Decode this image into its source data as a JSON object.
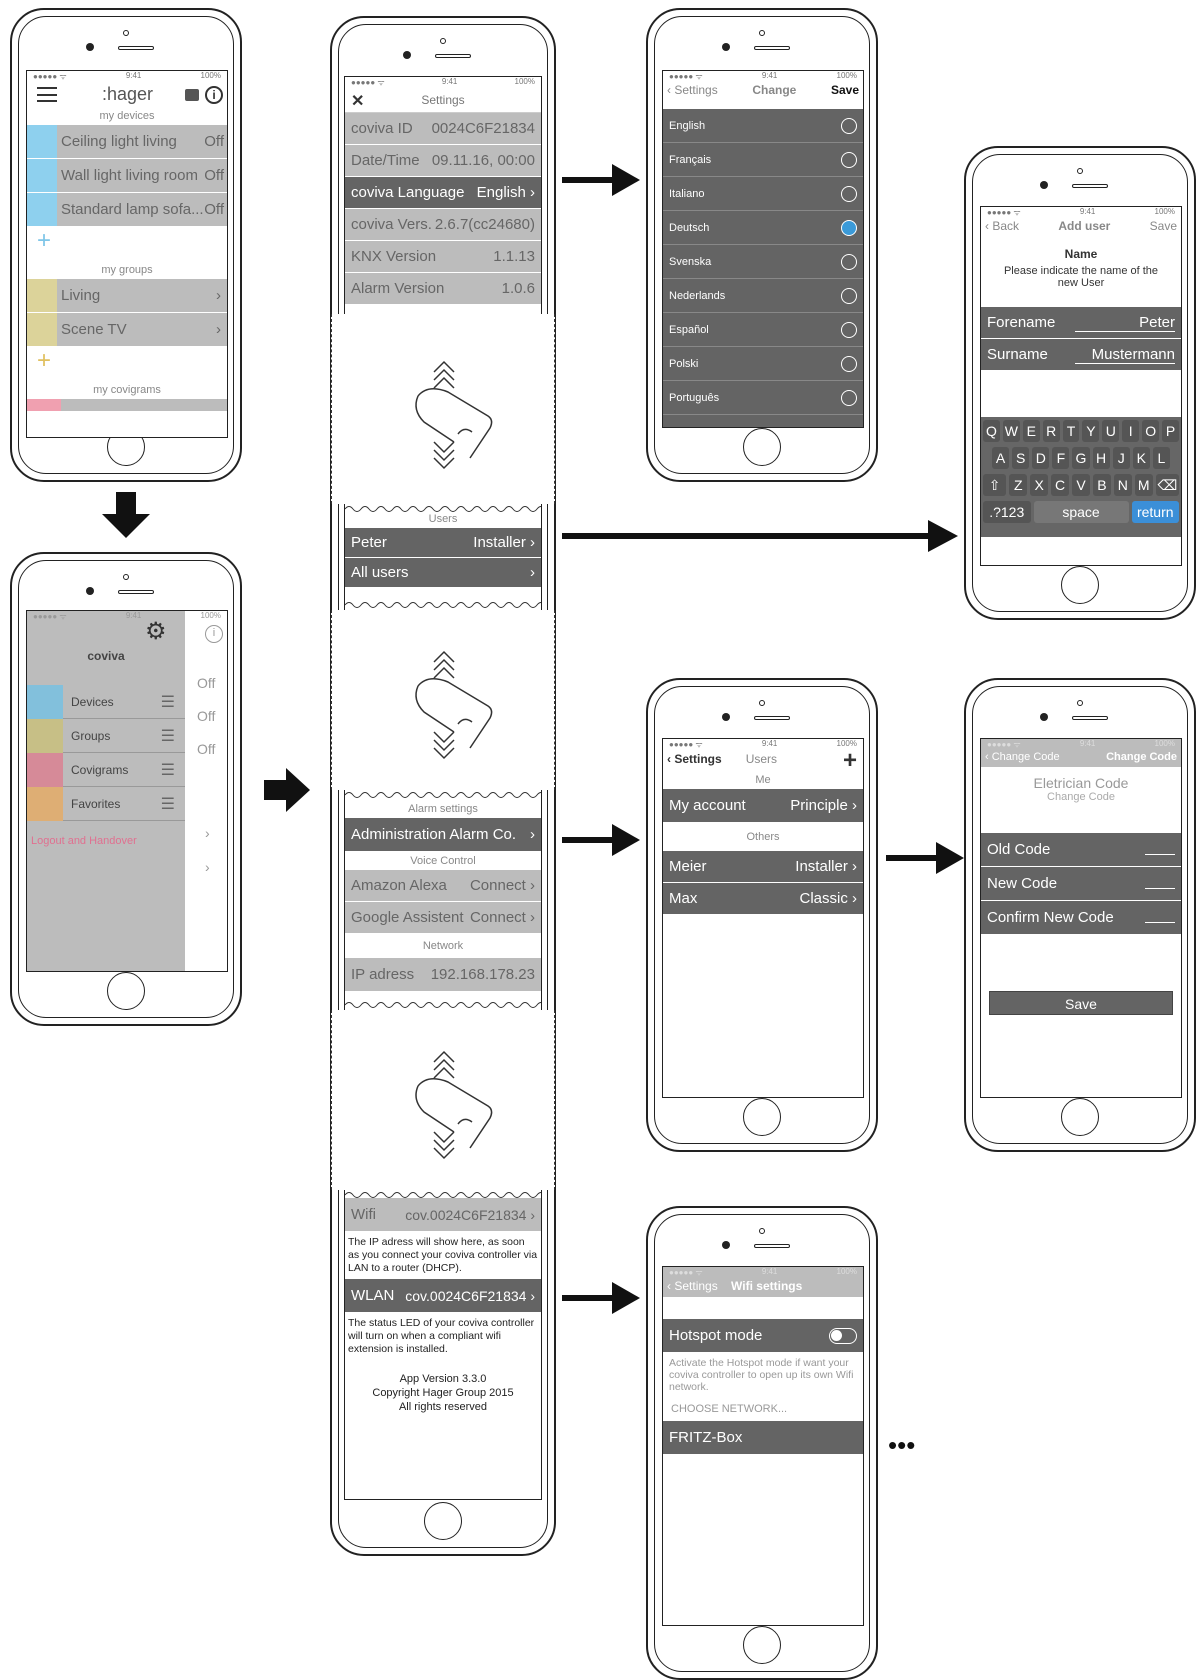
{
  "p1": {
    "status": {
      "carrier": "●●●●● ᯤ",
      "time": "9:41",
      "battery": "100%"
    },
    "logo": ":hager",
    "my_devices": "my devices",
    "devices": [
      {
        "name": "Ceiling light living",
        "state": "Off"
      },
      {
        "name": "Wall light living room",
        "state": "Off"
      },
      {
        "name": "Standard lamp sofa...",
        "state": "Off"
      }
    ],
    "my_groups": "my groups",
    "groups": [
      {
        "name": "Living"
      },
      {
        "name": "Scene TV"
      }
    ],
    "my_covigrams": "my covigrams",
    "plus": "+"
  },
  "p2": {
    "title": "coviva",
    "menu": [
      "Devices",
      "Groups",
      "Covigrams",
      "Favorites"
    ],
    "logout": "Logout and Handover",
    "offs": [
      "Off",
      "Off",
      "Off"
    ],
    "status": {
      "carrier": "●●●●● ᯤ",
      "time": "9:41",
      "battery": "100%"
    }
  },
  "settings": {
    "status": {
      "carrier": "●●●●● ᯤ",
      "time": "9:41",
      "battery": "100%"
    },
    "title": "Settings",
    "rows1": [
      {
        "k": "coviva ID",
        "v": "0024C6F21834"
      },
      {
        "k": "Date/Time",
        "v": "09.11.16, 00:00"
      },
      {
        "k": "coviva Language",
        "v": "English"
      },
      {
        "k": "coviva Vers.",
        "v": "2.6.7(cc24680)"
      },
      {
        "k": "KNX Version",
        "v": "1.1.13"
      },
      {
        "k": "Alarm Version",
        "v": "1.0.6"
      }
    ],
    "users_header": "Users",
    "users": [
      {
        "k": "Peter",
        "v": "Installer"
      },
      {
        "k": "All users",
        "v": ""
      }
    ],
    "alarm_header": "Alarm settings",
    "alarm_row": "Administration Alarm Co.",
    "voice_header": "Voice Control",
    "voice": [
      {
        "k": "Amazon Alexa",
        "v": "Connect"
      },
      {
        "k": "Google Assistent",
        "v": "Connect"
      }
    ],
    "network_header": "Network",
    "ip": {
      "k": "IP adress",
      "v": "192.168.178.23"
    },
    "wifi": {
      "k": "Wifi",
      "v": "cov.0024C6F21834"
    },
    "wifi_note": "The IP adress will show here, as soon as you connect your coviva controller via LAN to a router (DHCP).",
    "wlan": {
      "k": "WLAN",
      "v": "cov.0024C6F21834"
    },
    "wlan_note": "The status LED of your coviva controller will turn on when a compliant wifi extension is installed.",
    "footer": [
      "App Version 3.3.0",
      "Copyright Hager Group 2015",
      "All rights reserved"
    ]
  },
  "lang": {
    "status": {
      "carrier": "●●●●● ᯤ",
      "time": "9:41",
      "battery": "100%"
    },
    "back": "Settings",
    "title": "Change",
    "save": "Save",
    "languages": [
      "English",
      "Français",
      "Italiano",
      "Deutsch",
      "Svenska",
      "Nederlands",
      "Español",
      "Polski",
      "Português"
    ],
    "selected": "Deutsch"
  },
  "adduser": {
    "status": {
      "carrier": "●●●●● ᯤ",
      "time": "9:41",
      "battery": "100%"
    },
    "back": "Back",
    "title": "Add user",
    "save": "Save",
    "name_h": "Name",
    "prompt": "Please indicate the name of the new User",
    "fields": [
      {
        "k": "Forename",
        "v": "Peter"
      },
      {
        "k": "Surname",
        "v": "Mustermann"
      }
    ],
    "keys1": [
      "Q",
      "W",
      "E",
      "R",
      "T",
      "Y",
      "U",
      "I",
      "O",
      "P"
    ],
    "keys2": [
      "A",
      "S",
      "D",
      "F",
      "G",
      "H",
      "J",
      "K",
      "L"
    ],
    "keys3": [
      "Z",
      "X",
      "C",
      "V",
      "B",
      "N",
      "M"
    ],
    "k123": ".?123",
    "space": "space",
    "ret": "return"
  },
  "users": {
    "status": {
      "carrier": "●●●●● ᯤ",
      "time": "9:41",
      "battery": "100%"
    },
    "back": "Settings",
    "title": "Users",
    "me": "Me",
    "account": {
      "k": "My account",
      "v": "Principle"
    },
    "others": "Others",
    "list": [
      {
        "k": "Meier",
        "v": "Installer"
      },
      {
        "k": "Max",
        "v": "Classic"
      }
    ]
  },
  "code": {
    "status": {
      "carrier": "●●●●● ᯤ",
      "time": "9:41",
      "battery": "100%"
    },
    "back": "Change Code",
    "title": "Change Code",
    "h1": "Eletrician Code",
    "h2": "Change Code",
    "fields": [
      "Old Code",
      "New Code",
      "Confirm New Code"
    ],
    "save": "Save"
  },
  "wifi": {
    "status": {
      "carrier": "●●●●● ᯤ",
      "time": "9:41",
      "battery": "100%"
    },
    "back": "Settings",
    "title": "Wifi settings",
    "hotspot": "Hotspot mode",
    "hotspot_note": "Activate the Hotspot mode if want your coviva controller to open up its own Wifi network.",
    "choose": "CHOOSE NETWORK...",
    "network": "FRITZ-Box"
  },
  "ellipsis": "•••"
}
